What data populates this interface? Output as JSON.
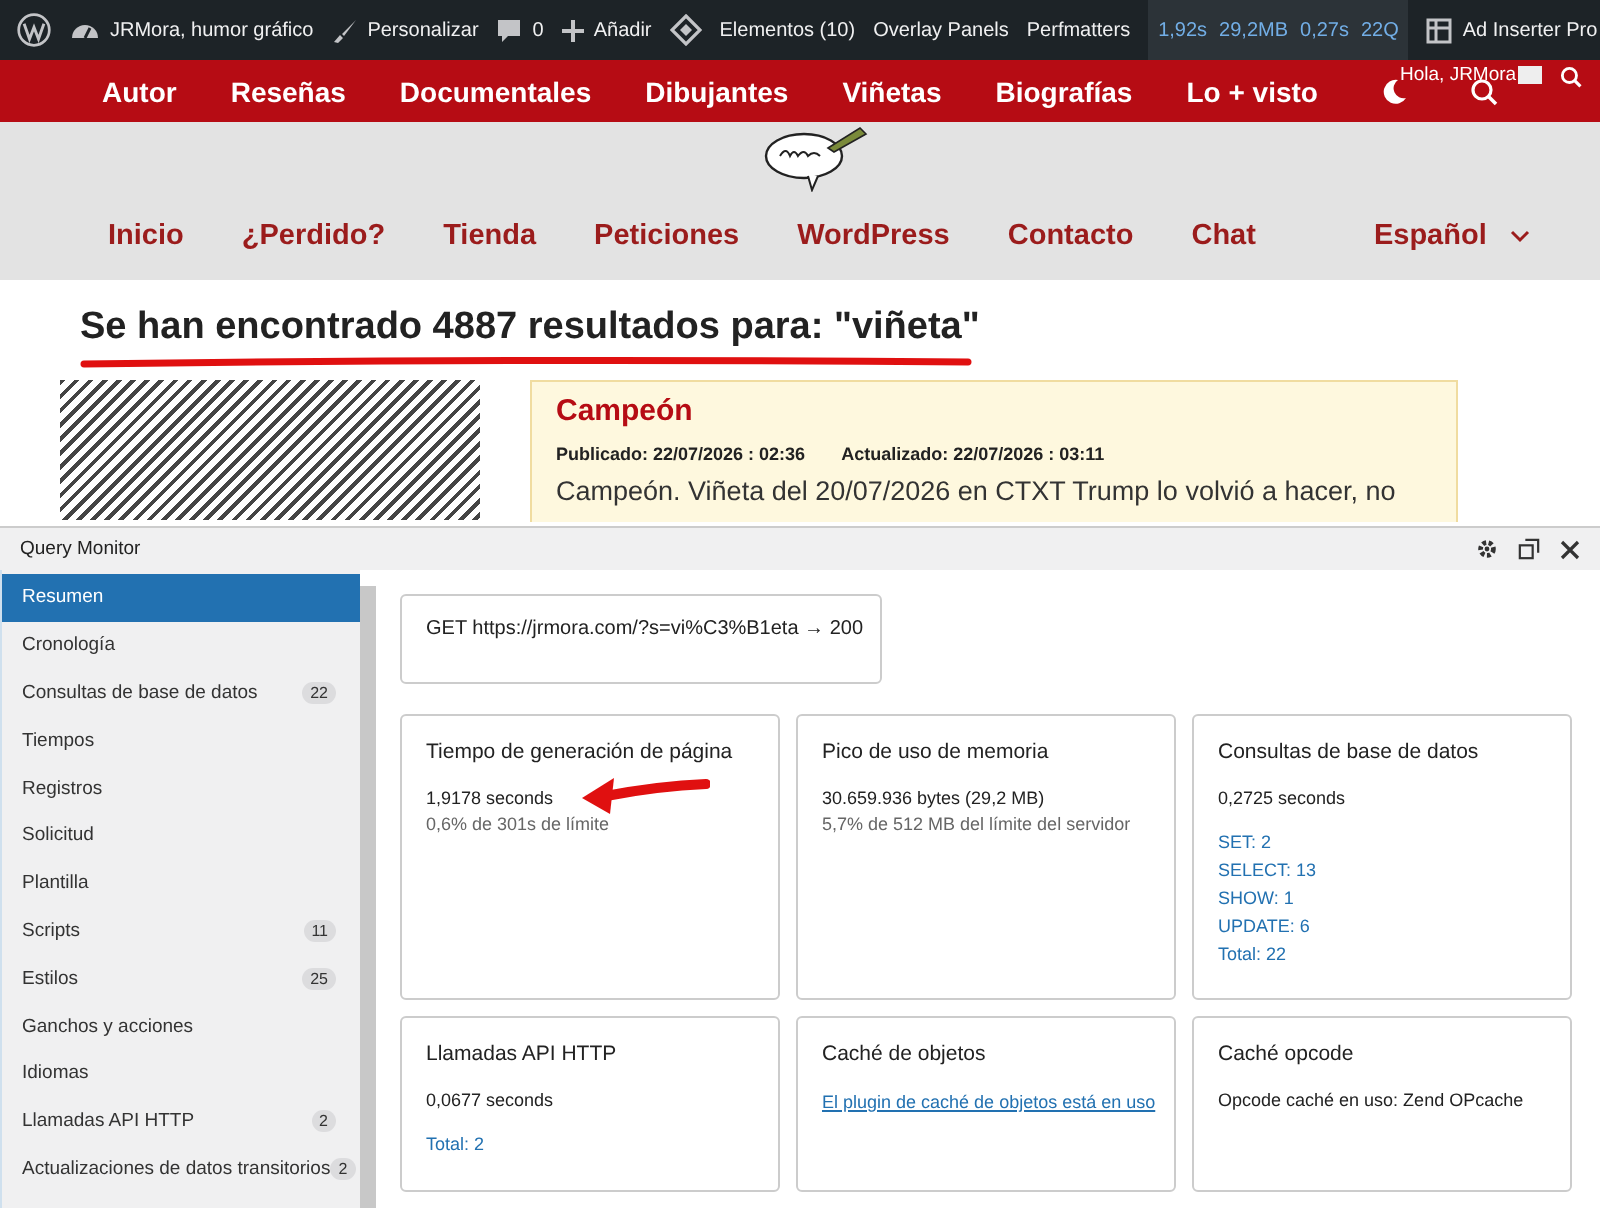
{
  "admin_bar": {
    "items": [
      {
        "kind": "wp"
      },
      {
        "kind": "site",
        "label": "JRMora, humor gráfico"
      },
      {
        "kind": "brush",
        "label": "Personalizar"
      },
      {
        "kind": "comment",
        "label": "0"
      },
      {
        "kind": "plus",
        "label": "Añadir"
      },
      {
        "kind": "diamond"
      },
      {
        "kind": "text",
        "label": "Elementos (10)"
      },
      {
        "kind": "text",
        "label": "Overlay Panels"
      },
      {
        "kind": "text",
        "label": "Perfmatters"
      }
    ],
    "stats": [
      "1,92s",
      "29,2MB",
      "0,27s",
      "22Q"
    ],
    "plugin": "Ad Inserter Pro"
  },
  "main_nav": {
    "items": [
      "Autor",
      "Reseñas",
      "Documentales",
      "Dibujantes",
      "Viñetas",
      "Biografías",
      "Lo + visto"
    ],
    "greeting": "Hola, JRMora"
  },
  "secondary_nav": {
    "items": [
      {
        "label": "Inicio",
        "dropdown": false
      },
      {
        "label": "¿Perdido?",
        "dropdown": false
      },
      {
        "label": "Tienda",
        "dropdown": false
      },
      {
        "label": "Peticiones",
        "dropdown": false
      },
      {
        "label": "WordPress",
        "dropdown": false
      },
      {
        "label": "Contacto",
        "dropdown": false
      },
      {
        "label": "Chat",
        "dropdown": false
      },
      {
        "label": "Español",
        "dropdown": true
      }
    ]
  },
  "search_heading": "Se han encontrado 4887 resultados para: \"viñeta\"",
  "post": {
    "title": "Campeón",
    "published": "Publicado: 22/07/2026 : 02:36",
    "updated": "Actualizado: 22/07/2026 : 03:11",
    "excerpt": "Campeón. Viñeta del 20/07/2026 en CTXT Trump lo volvió a hacer, no"
  },
  "query_monitor": {
    "title": "Query Monitor",
    "sidebar": [
      {
        "label": "Resumen",
        "selected": true
      },
      {
        "label": "Cronología",
        "selected": false
      },
      {
        "label": "Consultas de base de datos",
        "count": "22",
        "selected": false
      },
      {
        "label": "Tiempos",
        "selected": false
      },
      {
        "label": "Registros",
        "selected": false
      },
      {
        "label": "Solicitud",
        "selected": false
      },
      {
        "label": "Plantilla",
        "selected": false
      },
      {
        "label": "Scripts",
        "count": "11",
        "selected": false
      },
      {
        "label": "Estilos",
        "count": "25",
        "selected": false
      },
      {
        "label": "Ganchos y acciones",
        "selected": false
      },
      {
        "label": "Idiomas",
        "selected": false
      },
      {
        "label": "Llamadas API HTTP",
        "count": "2",
        "selected": false
      },
      {
        "label": "Actualizaciones de datos transitorios",
        "count": "2",
        "selected": false
      }
    ],
    "request": "GET https://jrmora.com/?s=vi%C3%B1eta → 200",
    "panels": [
      {
        "title": "Tiempo de generación de página",
        "arrow": true,
        "lines": [
          {
            "kind": "value",
            "text": "1,9178 seconds"
          },
          {
            "kind": "note",
            "text": "0,6% de 301s de límite"
          }
        ]
      },
      {
        "title": "Pico de uso de memoria",
        "arrow": false,
        "lines": [
          {
            "kind": "value",
            "text": "30.659.936 bytes (29,2 MB)"
          },
          {
            "kind": "note",
            "text": "5,7% de 512 MB del límite del servidor"
          }
        ]
      },
      {
        "title": "Consultas de base de datos",
        "arrow": false,
        "lines": [
          {
            "kind": "value",
            "text": "0,2725 seconds"
          },
          {
            "kind": "gap"
          },
          {
            "kind": "link",
            "text": "SET: 2"
          },
          {
            "kind": "link",
            "text": "SELECT: 13"
          },
          {
            "kind": "link",
            "text": "SHOW: 1"
          },
          {
            "kind": "link",
            "text": "UPDATE: 6"
          },
          {
            "kind": "link",
            "text": "Total: 22"
          }
        ]
      },
      {
        "title": "Llamadas API HTTP",
        "arrow": false,
        "lines": [
          {
            "kind": "value",
            "text": "0,0677 seconds"
          },
          {
            "kind": "gap"
          },
          {
            "kind": "link",
            "text": "Total: 2"
          }
        ]
      },
      {
        "title": "Caché de objetos",
        "arrow": false,
        "lines": [
          {
            "kind": "underlined",
            "text": "El plugin de caché de objetos está en uso"
          }
        ]
      },
      {
        "title": "Caché opcode",
        "arrow": false,
        "lines": [
          {
            "kind": "value",
            "text": "Opcode caché en uso: Zend OPcache"
          }
        ]
      }
    ]
  }
}
